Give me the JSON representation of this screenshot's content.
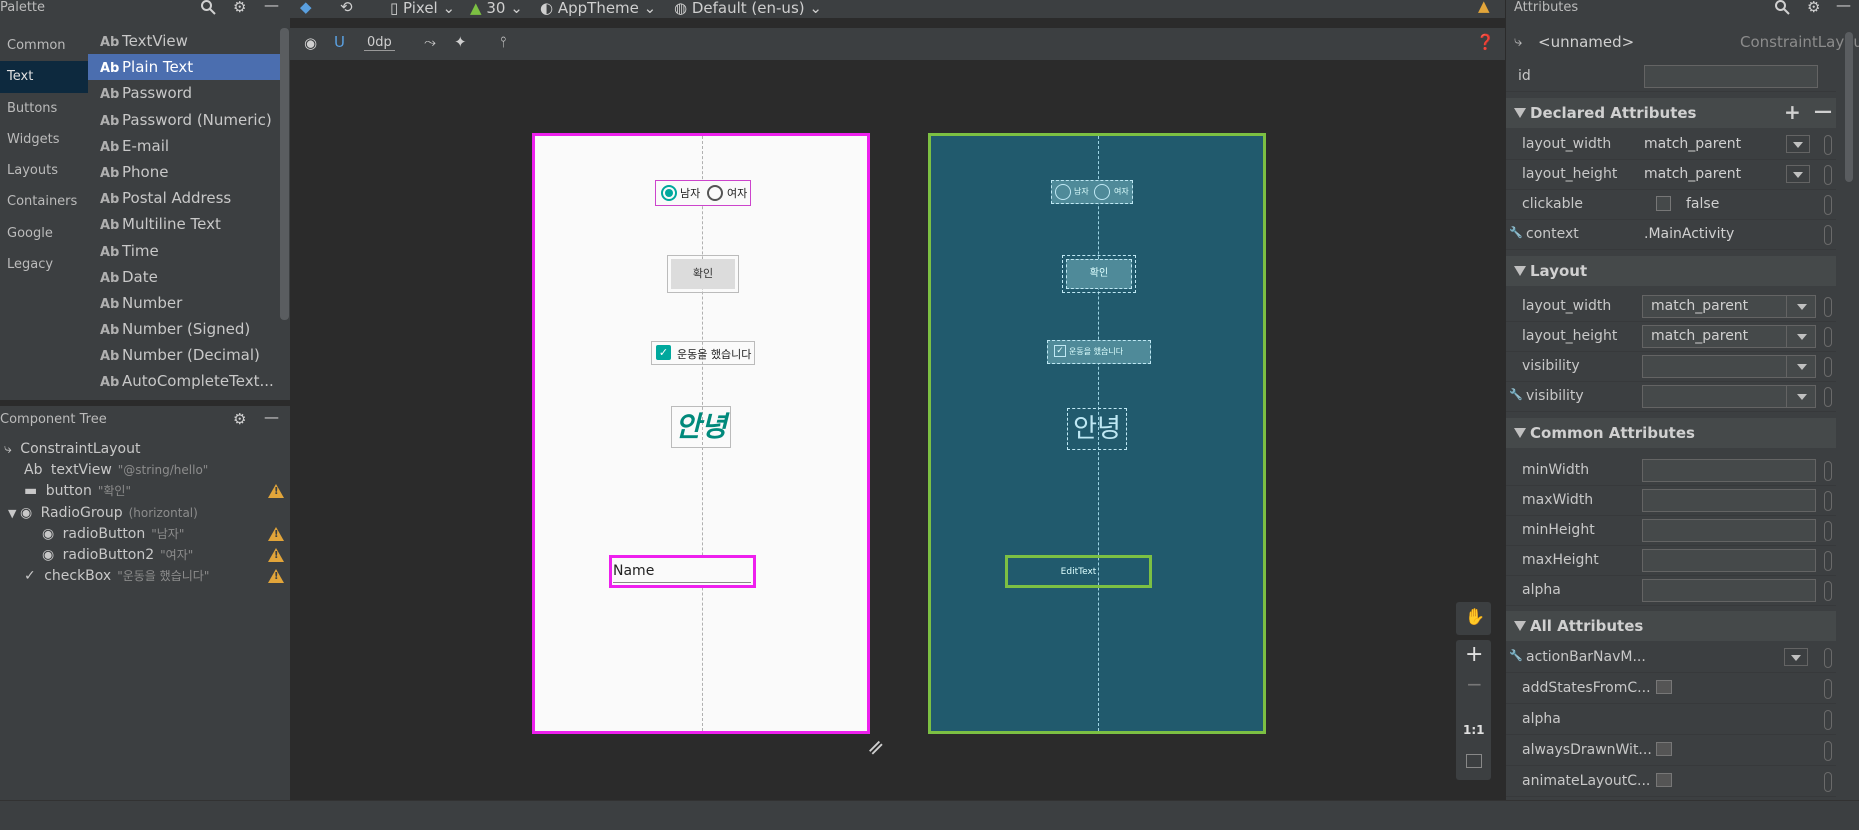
{
  "palette": {
    "title": "Palette",
    "categories": [
      "Common",
      "Text",
      "Buttons",
      "Widgets",
      "Layouts",
      "Containers",
      "Google",
      "Legacy"
    ],
    "selected_category": "Text",
    "items": [
      "TextView",
      "Plain Text",
      "Password",
      "Password (Numeric)",
      "E-mail",
      "Phone",
      "Postal Address",
      "Multiline Text",
      "Time",
      "Date",
      "Number",
      "Number (Signed)",
      "Number (Decimal)",
      "AutoCompleteText..."
    ],
    "selected_item": "Plain Text",
    "icon_prefix": "Ab"
  },
  "component_tree": {
    "title": "Component Tree",
    "rows": [
      {
        "label": "ConstraintLayout",
        "sub": ""
      },
      {
        "label": "textView",
        "sub": "\"@string/hello\""
      },
      {
        "label": "button",
        "sub": "\"확인\""
      },
      {
        "label": "RadioGroup",
        "sub": "(horizontal)"
      },
      {
        "label": "radioButton",
        "sub": "\"남자\""
      },
      {
        "label": "radioButton2",
        "sub": "\"여자\""
      },
      {
        "label": "checkBox",
        "sub": "\"운동을 했습니다\""
      }
    ]
  },
  "toolbar": {
    "device": "Pixel",
    "api": "30",
    "theme": "AppTheme",
    "locale": "Default (en-us)",
    "margin": "0dp"
  },
  "design": {
    "radio_male": "남자",
    "radio_female": "여자",
    "button": "확인",
    "checkbox": "운동을 했습니다",
    "hello": "안녕",
    "edit_text": "Name",
    "blueprint_edit": "EditText"
  },
  "zoom": {
    "one_to_one": "1:1"
  },
  "attributes": {
    "title": "Attributes",
    "component_name": "<unnamed>",
    "component_type": "ConstraintLayout",
    "id_label": "id",
    "declared_title": "Declared Attributes",
    "declared": [
      {
        "name": "layout_width",
        "value": "match_parent"
      },
      {
        "name": "layout_height",
        "value": "match_parent"
      },
      {
        "name": "clickable",
        "value": "false"
      },
      {
        "name": "context",
        "value": ".MainActivity"
      }
    ],
    "layout_title": "Layout",
    "layout": [
      {
        "name": "layout_width",
        "value": "match_parent"
      },
      {
        "name": "layout_height",
        "value": "match_parent"
      },
      {
        "name": "visibility",
        "value": ""
      },
      {
        "name": "visibility",
        "value": ""
      }
    ],
    "common_title": "Common Attributes",
    "common": [
      "minWidth",
      "maxWidth",
      "minHeight",
      "maxHeight",
      "alpha"
    ],
    "all_title": "All Attributes",
    "all": [
      "actionBarNavM...",
      "addStatesFromC...",
      "alpha",
      "alwaysDrawnWit...",
      "animateLayoutC..."
    ]
  },
  "colors": {
    "selection_blue": "#4b6eaf",
    "design_border": "#ee20ee",
    "blueprint_bg": "#215a6d",
    "blueprint_border": "#7cc043",
    "warning": "#e2a53a",
    "accent_teal": "#00a89d"
  }
}
